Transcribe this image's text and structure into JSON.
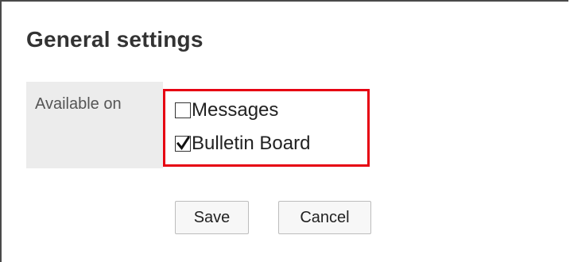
{
  "page": {
    "title": "General settings"
  },
  "settings": {
    "available_on_label": "Available on",
    "options": [
      {
        "label": "Messages",
        "checked": false
      },
      {
        "label": "Bulletin Board",
        "checked": true
      }
    ]
  },
  "actions": {
    "save_label": "Save",
    "cancel_label": "Cancel"
  },
  "colors": {
    "highlight": "#e60012",
    "label_background": "#ececec"
  }
}
